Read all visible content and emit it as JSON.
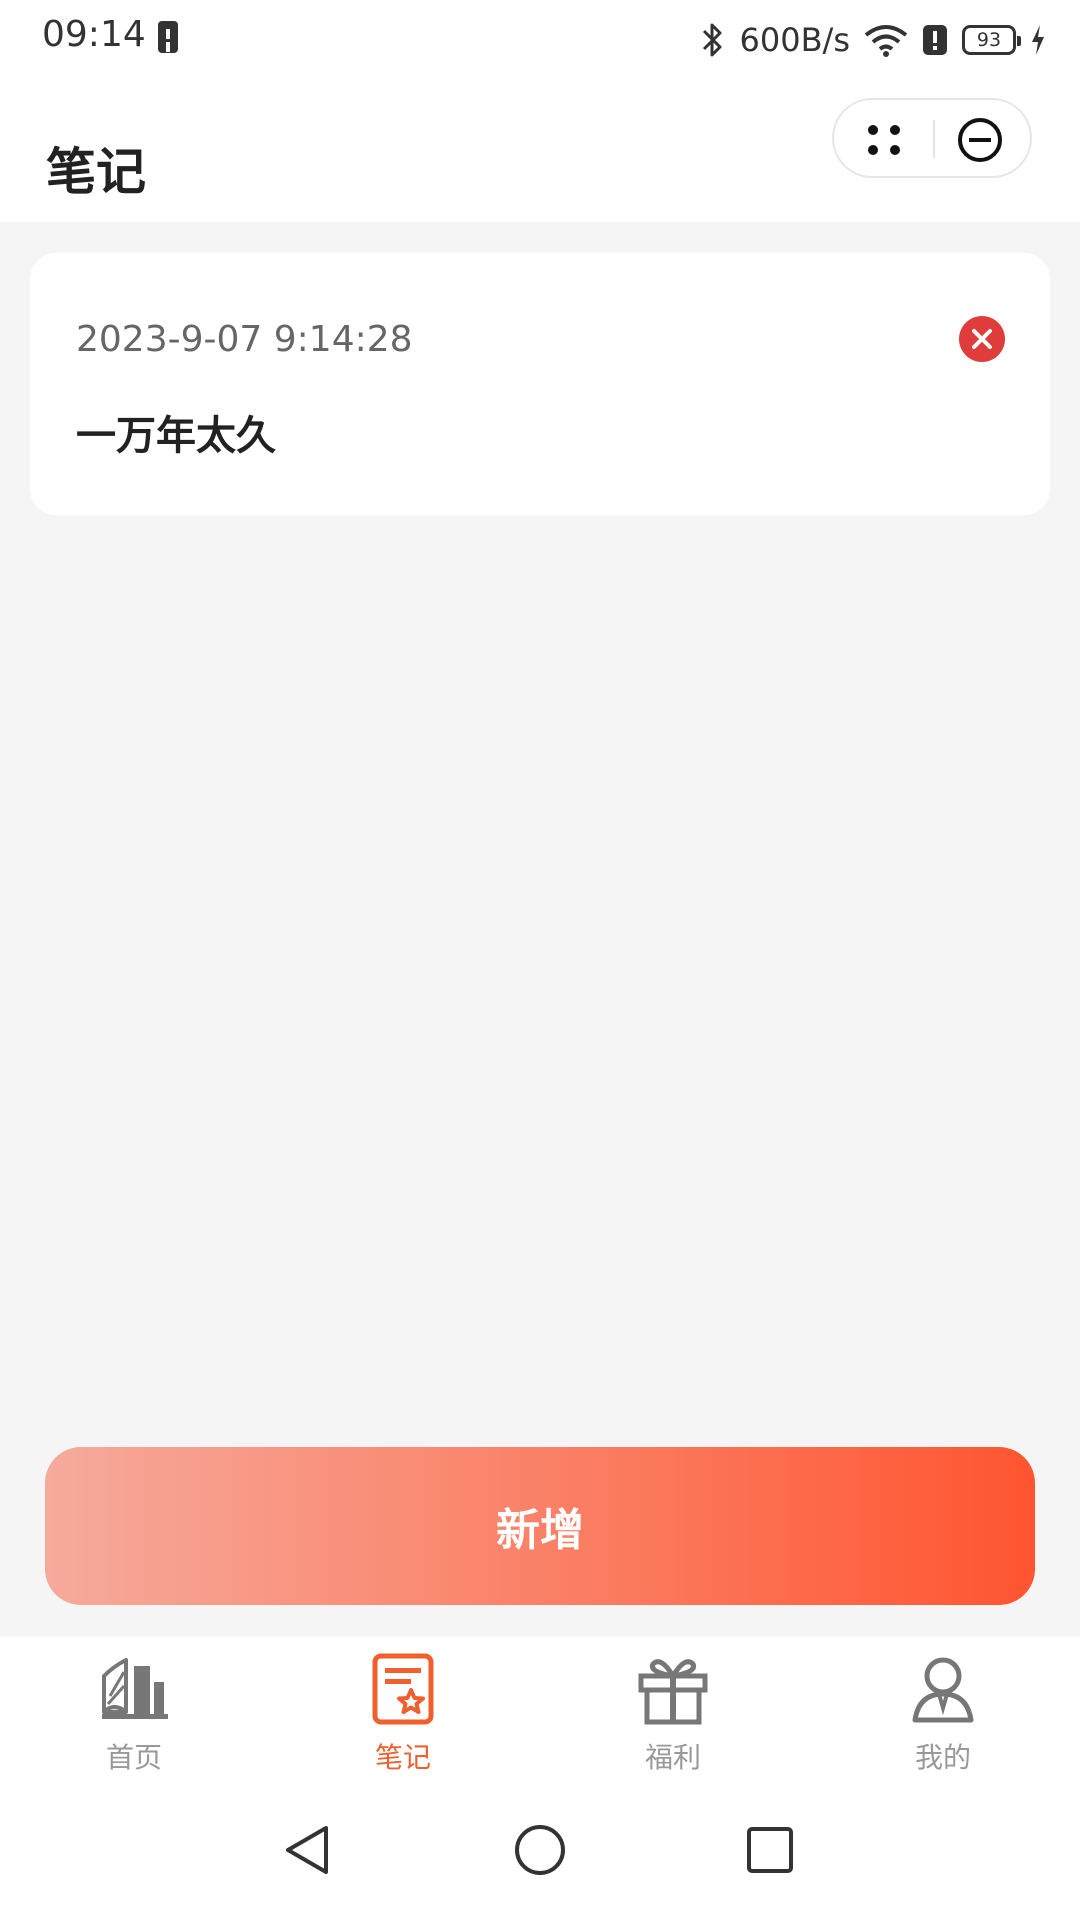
{
  "status_bar": {
    "time": "09:14",
    "network_speed": "600B/s",
    "battery_level": "93"
  },
  "header": {
    "title": "笔记"
  },
  "notes": [
    {
      "timestamp": "2023-9-07 9:14:28",
      "title": "一万年太久"
    }
  ],
  "add_button": {
    "label": "新增"
  },
  "tabs": [
    {
      "label": "首页",
      "icon": "book-icon",
      "active": false
    },
    {
      "label": "笔记",
      "icon": "note-star-icon",
      "active": true
    },
    {
      "label": "福利",
      "icon": "gift-icon",
      "active": false
    },
    {
      "label": "我的",
      "icon": "person-icon",
      "active": false
    }
  ],
  "colors": {
    "accent": "#f0602f",
    "delete": "#e03c3c",
    "button_gradient_start": "#f6aa9c",
    "button_gradient_end": "#ff5530"
  }
}
